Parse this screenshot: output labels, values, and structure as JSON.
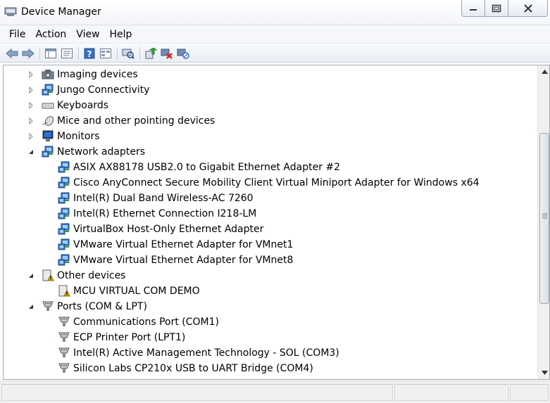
{
  "window": {
    "title": "Device Manager"
  },
  "menu": [
    "File",
    "Action",
    "View",
    "Help"
  ],
  "toolbar": [
    "back-arrow-icon",
    "forward-arrow-icon",
    "console-tree-icon",
    "properties-icon",
    "help-icon",
    "view-icon",
    "scan-hardware-icon",
    "update-driver-icon",
    "uninstall-icon",
    "disable-device-icon"
  ],
  "tree": {
    "categories": [
      {
        "label": "Imaging devices",
        "expanded": false,
        "icon": "camera-icon"
      },
      {
        "label": "Jungo Connectivity",
        "expanded": false,
        "icon": "network-icon"
      },
      {
        "label": "Keyboards",
        "expanded": false,
        "icon": "keyboard-icon"
      },
      {
        "label": "Mice and other pointing devices",
        "expanded": false,
        "icon": "mouse-icon"
      },
      {
        "label": "Monitors",
        "expanded": false,
        "icon": "monitor-icon"
      },
      {
        "label": "Network adapters",
        "expanded": true,
        "icon": "network-icon",
        "children": [
          "ASIX AX88178 USB2.0 to Gigabit Ethernet Adapter #2",
          "Cisco AnyConnect Secure Mobility Client Virtual Miniport Adapter for Windows x64",
          "Intel(R) Dual Band Wireless-AC 7260",
          "Intel(R) Ethernet Connection I218-LM",
          "VirtualBox Host-Only Ethernet Adapter",
          "VMware Virtual Ethernet Adapter for VMnet1",
          "VMware Virtual Ethernet Adapter for VMnet8"
        ]
      },
      {
        "label": "Other devices",
        "expanded": true,
        "icon": "unknown-device-icon",
        "children": [
          "MCU VIRTUAL COM DEMO"
        ]
      },
      {
        "label": "Ports (COM & LPT)",
        "expanded": true,
        "icon": "port-icon",
        "children": [
          "Communications Port (COM1)",
          "ECP Printer Port (LPT1)",
          "Intel(R) Active Management Technology - SOL (COM3)",
          "Silicon Labs CP210x USB to UART Bridge (COM4)"
        ]
      }
    ]
  }
}
